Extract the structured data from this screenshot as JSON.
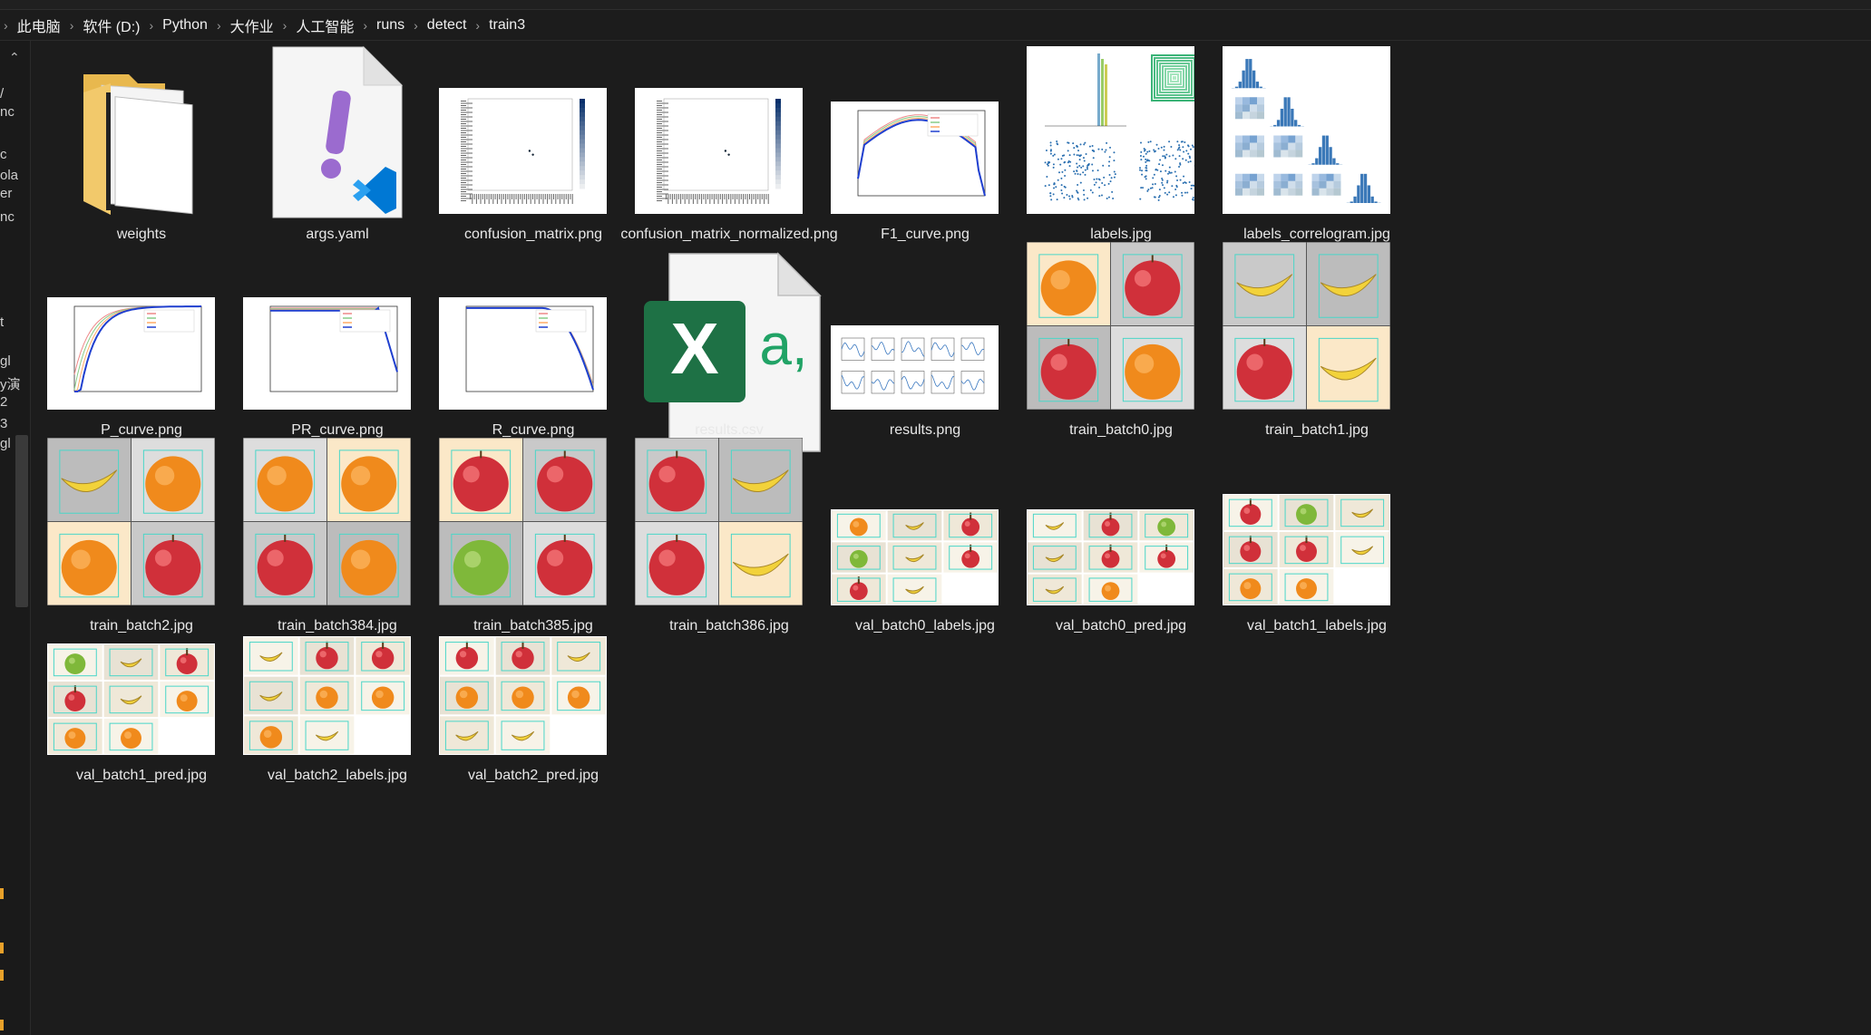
{
  "breadcrumb": [
    "此电脑",
    "软件 (D:)",
    "Python",
    "大作业",
    "人工智能",
    "runs",
    "detect",
    "train3"
  ],
  "left_pane": {
    "truncated_items": [
      "/",
      "nc",
      "c",
      "ola",
      "er",
      "nc",
      "t",
      "gl",
      "y演",
      "2",
      "3",
      "gl"
    ]
  },
  "files": [
    {
      "name": "weights",
      "kind": "folder"
    },
    {
      "name": "args.yaml",
      "kind": "yaml"
    },
    {
      "name": "confusion_matrix.png",
      "kind": "matrix"
    },
    {
      "name": "confusion_matrix_normalized.png",
      "kind": "matrix"
    },
    {
      "name": "F1_curve.png",
      "kind": "curve"
    },
    {
      "name": "labels.jpg",
      "kind": "labels"
    },
    {
      "name": "labels_correlogram.jpg",
      "kind": "correlogram"
    },
    {
      "name": "P_curve.png",
      "kind": "curve"
    },
    {
      "name": "PR_curve.png",
      "kind": "curve"
    },
    {
      "name": "R_curve.png",
      "kind": "curve"
    },
    {
      "name": "results.csv",
      "kind": "csv"
    },
    {
      "name": "results.png",
      "kind": "results"
    },
    {
      "name": "train_batch0.jpg",
      "kind": "batch"
    },
    {
      "name": "train_batch1.jpg",
      "kind": "batch"
    },
    {
      "name": "train_batch2.jpg",
      "kind": "batch"
    },
    {
      "name": "train_batch384.jpg",
      "kind": "batch"
    },
    {
      "name": "train_batch385.jpg",
      "kind": "batch"
    },
    {
      "name": "train_batch386.jpg",
      "kind": "batch"
    },
    {
      "name": "val_batch0_labels.jpg",
      "kind": "val"
    },
    {
      "name": "val_batch0_pred.jpg",
      "kind": "val"
    },
    {
      "name": "val_batch1_labels.jpg",
      "kind": "val"
    },
    {
      "name": "val_batch1_pred.jpg",
      "kind": "val"
    },
    {
      "name": "val_batch2_labels.jpg",
      "kind": "val"
    },
    {
      "name": "val_batch2_pred.jpg",
      "kind": "val"
    }
  ],
  "colors": {
    "background": "#1c1c1c",
    "folder": "#f2c96b",
    "excel_green": "#1e7145",
    "vscode_blue": "#0078d4",
    "yaml_purple": "#9b6bcf",
    "curve_blue": "#1f3fcf"
  }
}
